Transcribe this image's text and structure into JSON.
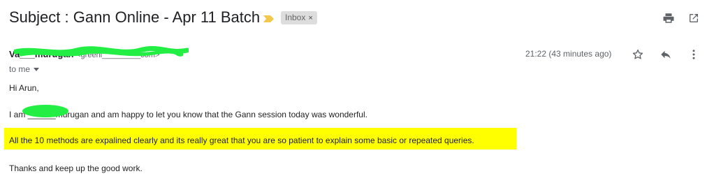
{
  "email": {
    "subject": "Subject : Gann Online - Apr 11 Batch",
    "label_chip": "Inbox",
    "label_remove": "×",
    "sender_name": "Va___murugan",
    "sender_email": "<greeni_________com>",
    "recipient_text": "to me",
    "timestamp": "21:22 (43 minutes ago)",
    "body": {
      "greeting": "Hi Arun,",
      "line1": "I am ______murugan and am happy to let you know that the Gann session today was wonderful.",
      "line2": "All the 10 methods are expalined clearly and its really great that you are so patient to explain some basic or repeated queries.",
      "closing": "Thanks and keep up the good work."
    }
  },
  "icons": {
    "importance": "importance-marker-icon",
    "print": "print-icon",
    "new_window": "open-in-new-window-icon",
    "star": "star-icon",
    "reply": "reply-icon",
    "more": "more-vert-icon"
  },
  "colors": {
    "highlight": "#ffff00",
    "redaction": "#22ee44",
    "importance": "#f2c94c",
    "chip_bg": "#dddddd"
  }
}
